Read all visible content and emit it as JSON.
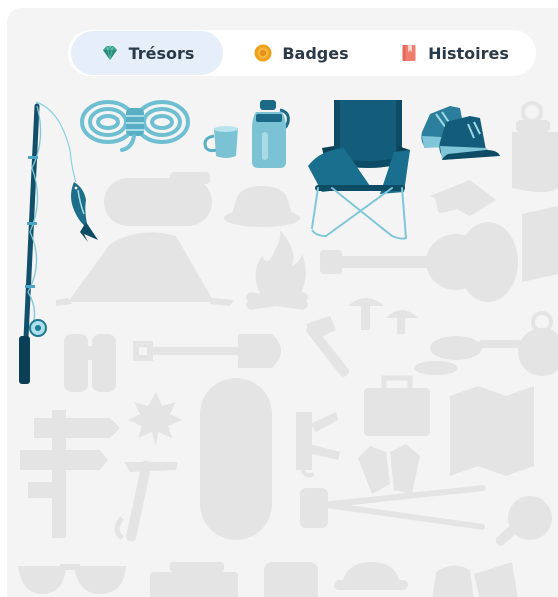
{
  "tabs": [
    {
      "label": "Trésors",
      "icon": "gem-icon",
      "active": true
    },
    {
      "label": "Badges",
      "icon": "coin-badge-icon",
      "active": false
    },
    {
      "label": "Histoires",
      "icon": "book-icon",
      "active": false
    }
  ],
  "collection": {
    "unlocked": [
      "fishing-rod",
      "rope-coil",
      "mug",
      "water-bottle",
      "camping-chair",
      "hiking-boots"
    ],
    "locked": [
      "lantern",
      "sleeping-pad",
      "bucket-hat",
      "wallet",
      "tent",
      "campfire",
      "guitar",
      "map",
      "binoculars",
      "shovel",
      "mushrooms",
      "axe",
      "frying-pan",
      "compass",
      "trail-sign",
      "maple-leaf",
      "sleeping-bag",
      "swiss-army-knife",
      "first-aid-kit",
      "folded-map",
      "ice-axe",
      "gloves",
      "trekking-poles",
      "magnifier",
      "sunglasses",
      "mat",
      "jar",
      "cap",
      "bag"
    ]
  },
  "colors": {
    "background": "#f4f4f4",
    "silhouette": "#e4e4e4",
    "accent_dark": "#0e4c66",
    "accent_mid": "#1f6e8a",
    "accent_light": "#7fc6d8",
    "tab_active_bg": "#e6eef9",
    "text": "#2b3a4a"
  }
}
